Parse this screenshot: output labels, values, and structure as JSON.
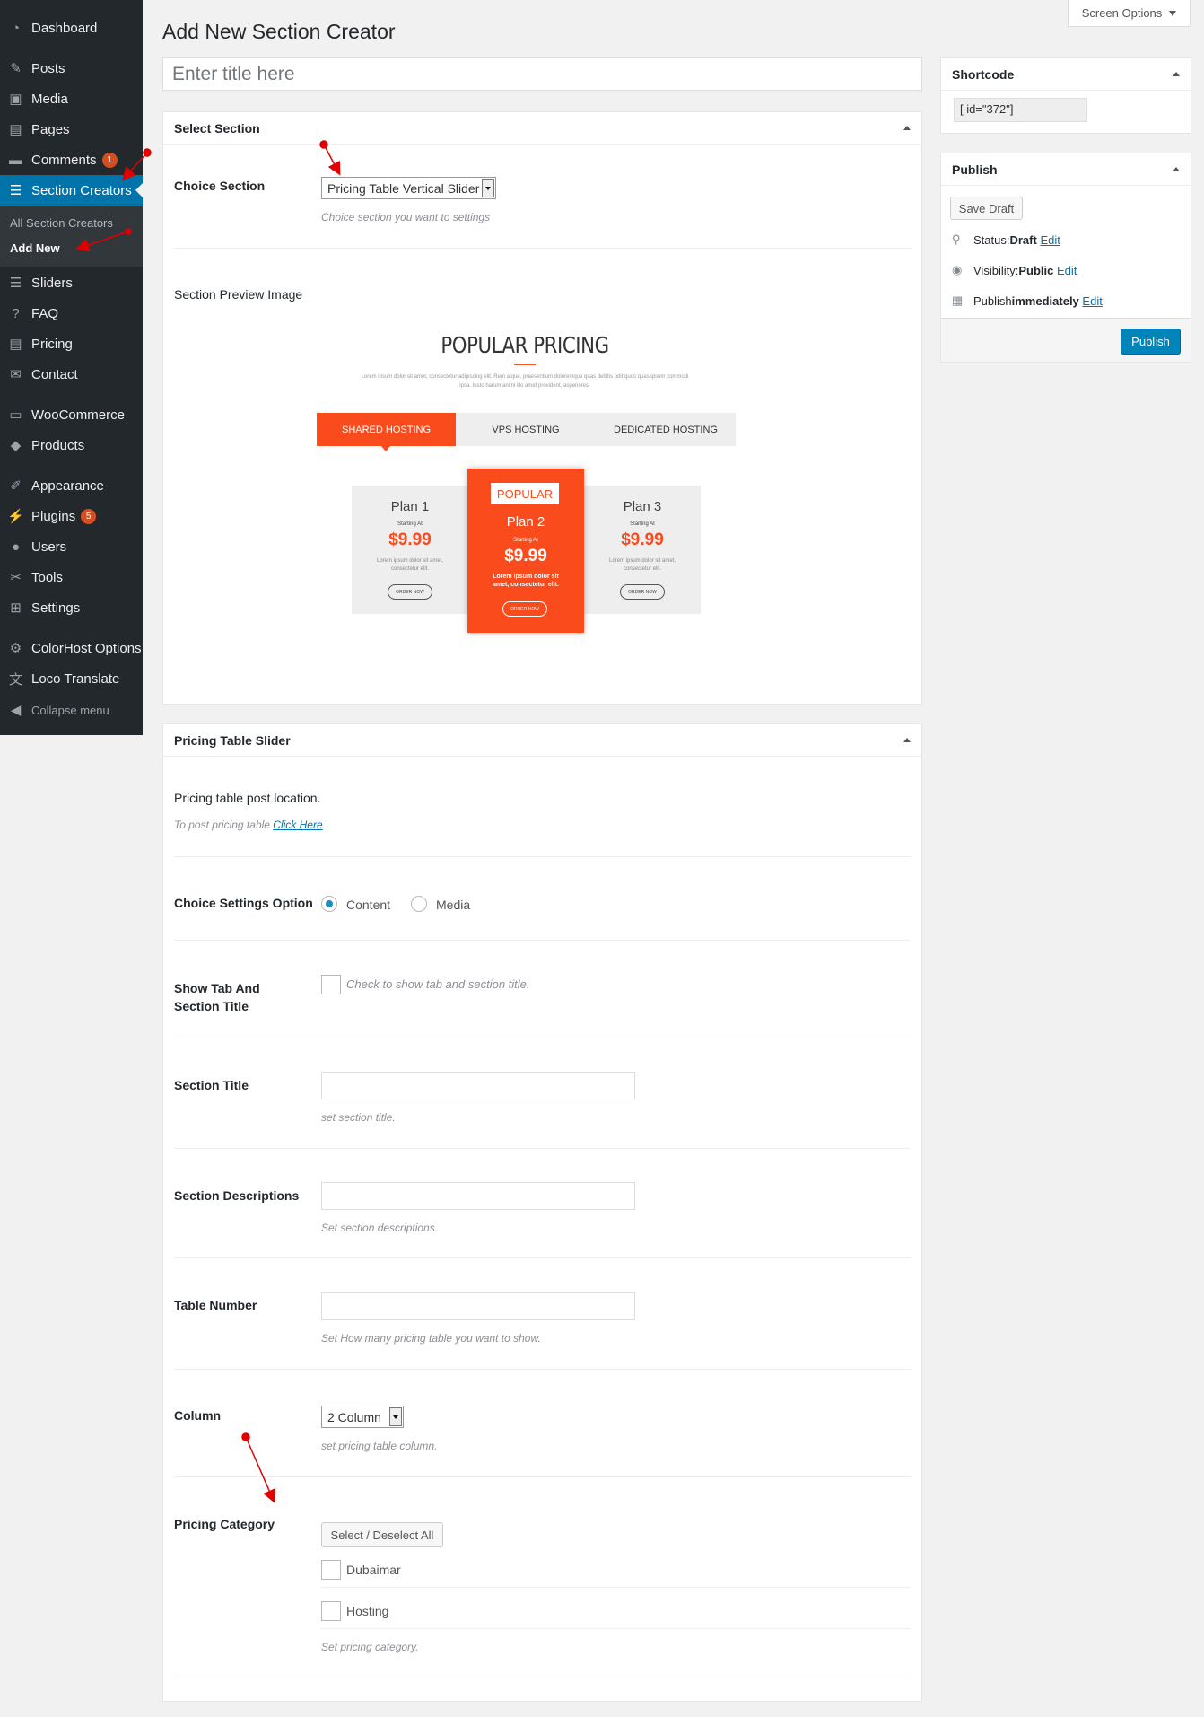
{
  "sidebar": {
    "items": [
      {
        "label": "Dashboard",
        "icon": "dashboard-icon",
        "glyph": "◔"
      },
      {
        "label": "Posts",
        "icon": "pin-icon",
        "glyph": "✎"
      },
      {
        "label": "Media",
        "icon": "media-icon",
        "glyph": "▣"
      },
      {
        "label": "Pages",
        "icon": "pages-icon",
        "glyph": "▤"
      },
      {
        "label": "Comments",
        "icon": "comments-icon",
        "glyph": "▬",
        "badge": "1"
      },
      {
        "label": "Section Creators",
        "icon": "section-icon",
        "glyph": "☰"
      },
      {
        "label": "Sliders",
        "icon": "sliders-icon",
        "glyph": "☰"
      },
      {
        "label": "FAQ",
        "icon": "help-icon",
        "glyph": "?"
      },
      {
        "label": "Pricing",
        "icon": "pricing-icon",
        "glyph": "▤"
      },
      {
        "label": "Contact",
        "icon": "mail-icon",
        "glyph": "✉"
      },
      {
        "label": "WooCommerce",
        "icon": "woo-icon",
        "glyph": "▭"
      },
      {
        "label": "Products",
        "icon": "products-icon",
        "glyph": "◆"
      },
      {
        "label": "Appearance",
        "icon": "brush-icon",
        "glyph": "✐"
      },
      {
        "label": "Plugins",
        "icon": "plugin-icon",
        "glyph": "⚡",
        "badge": "5"
      },
      {
        "label": "Users",
        "icon": "users-icon",
        "glyph": "●"
      },
      {
        "label": "Tools",
        "icon": "tools-icon",
        "glyph": "✂"
      },
      {
        "label": "Settings",
        "icon": "settings-icon",
        "glyph": "⊞"
      },
      {
        "label": "ColorHost Options",
        "icon": "gear-icon",
        "glyph": "⚙"
      },
      {
        "label": "Loco Translate",
        "icon": "translate-icon",
        "glyph": "文"
      },
      {
        "label": "Collapse menu",
        "icon": "collapse-icon",
        "glyph": "◀"
      }
    ],
    "submenu": {
      "all": "All Section Creators",
      "add_new": "Add New"
    }
  },
  "header": {
    "screen_options": "Screen Options",
    "page_title": "Add New Section Creator",
    "title_placeholder": "Enter title here"
  },
  "select_section": {
    "box_title": "Select Section",
    "choice_label": "Choice Section",
    "choice_value": "Pricing Table Vertical Slider",
    "choice_desc": "Choice section you want to settings",
    "preview_label": "Section Preview Image"
  },
  "preview": {
    "title": "POPULAR PRICING",
    "subtitle": "Lorem ipsum dolor sit amet, consectetur adipiscing elit. Rem atque, praesentium doloremque quas debitis odit quos quas ipsum commodi ipsa. Iusto harum animi illo amet provident, asperiores.",
    "tabs": [
      "SHARED HOSTING",
      "VPS HOSTING",
      "DEDICATED HOSTING"
    ],
    "cards": [
      {
        "plan": "Plan 1",
        "starting": "Starting At",
        "price": "$9.99",
        "desc": "Lorem ipsum dolor sit amet, consectetur elit.",
        "order": "ORDER NOW"
      },
      {
        "plan": "Plan 2",
        "starting": "Starting At",
        "price": "$9.99",
        "desc": "Lorem ipsum dolor sit amet, consectetur elit.",
        "order": "ORDER NOW",
        "badge": "POPULAR"
      },
      {
        "plan": "Plan 3",
        "starting": "Starting At",
        "price": "$9.99",
        "desc": "Lorem ipsum dolor sit amet, consectetur elit.",
        "order": "ORDER NOW"
      }
    ],
    "accent": "#fa4b1d"
  },
  "pricing_slider": {
    "box_title": "Pricing Table Slider",
    "location_label": "Pricing table post location.",
    "location_desc_prefix": "To post pricing table ",
    "location_link": "Click Here",
    "location_desc_suffix": ".",
    "settings_label": "Choice Settings Option",
    "radio_content": "Content",
    "radio_media": "Media",
    "show_tab_label": "Show Tab And Section Title",
    "show_tab_desc": "Check to show tab and section title.",
    "section_title_label": "Section Title",
    "section_title_desc": "set section title.",
    "section_desc_label": "Section Descriptions",
    "section_desc_desc": "Set section descriptions.",
    "table_number_label": "Table Number",
    "table_number_desc": "Set How many pricing table you want to show.",
    "column_label": "Column",
    "column_value": "2 Column",
    "column_desc": "set pricing table column.",
    "category_label": "Pricing Category",
    "select_all": "Select / Deselect All",
    "cat1": "Dubaimar",
    "cat2": "Hosting",
    "category_desc": "Set pricing category."
  },
  "shortcode": {
    "title": "Shortcode",
    "value": "[ id=\"372\"]"
  },
  "publish": {
    "title": "Publish",
    "save_draft": "Save Draft",
    "status_label": "Status: ",
    "status_value": "Draft",
    "visibility_label": "Visibility: ",
    "visibility_value": "Public",
    "publish_label": "Publish ",
    "publish_value": "immediately",
    "edit": "Edit",
    "publish_button": "Publish"
  },
  "colors": {
    "sidebar_bg": "#23282d",
    "active": "#0073aa",
    "primary_button": "#0085ba",
    "annotation": "#e00000"
  }
}
